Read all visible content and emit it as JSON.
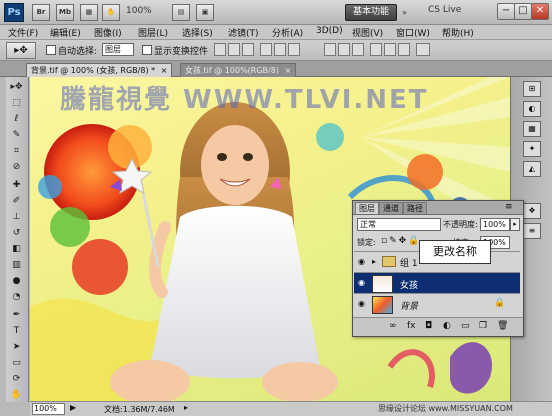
{
  "app": {
    "logo": "Ps",
    "bar_icons": [
      "Br",
      "Mb"
    ],
    "zoom": "100%",
    "workspace": "基本功能",
    "cs_live": "CS Live",
    "window_buttons": [
      "−",
      "□",
      "✕"
    ]
  },
  "menu": [
    "文件(F)",
    "编辑(E)",
    "图像(I)",
    "图层(L)",
    "选择(S)",
    "滤镜(T)",
    "分析(A)",
    "3D(D)",
    "视图(V)",
    "窗口(W)",
    "帮助(H)"
  ],
  "options": {
    "auto_select_label": "自动选择:",
    "auto_select_value": "图层",
    "show_transform_label": "显示变换控件"
  },
  "tabs": [
    {
      "label": "背景.tif @ 100% (女孩, RGB/8) *",
      "close": "×"
    },
    {
      "label": "女孩.tif @ 100%(RGB/8)",
      "close": "×"
    }
  ],
  "watermark": "騰龍視覺 WWW.TLVI.NET",
  "layers_panel": {
    "tabs": [
      "图层",
      "通道",
      "路径"
    ],
    "blend_mode": "正常",
    "opacity_label": "不透明度:",
    "opacity_value": "100%",
    "lock_label": "锁定:",
    "fill_label": "填充:",
    "fill_value": "100%",
    "layers": [
      {
        "name": "组 1",
        "type": "group",
        "selected": false
      },
      {
        "name": "女孩",
        "type": "layer",
        "selected": true
      },
      {
        "name": "背景",
        "type": "background",
        "selected": false
      }
    ]
  },
  "tooltip": "更改名称",
  "status": {
    "zoom": "100%",
    "doc": "文档:1.36M/7.46M"
  },
  "footer_watermark": "思缘设计论坛 www.MISSYUAN.COM",
  "icons": {
    "move_tool": "move-arrow-icon",
    "eye": "eye-icon",
    "lock": "lock-icon",
    "folder": "folder-icon"
  },
  "colors": {
    "selected_layer": "#0e2e73",
    "workspace_btn": "#4a4a4a"
  }
}
